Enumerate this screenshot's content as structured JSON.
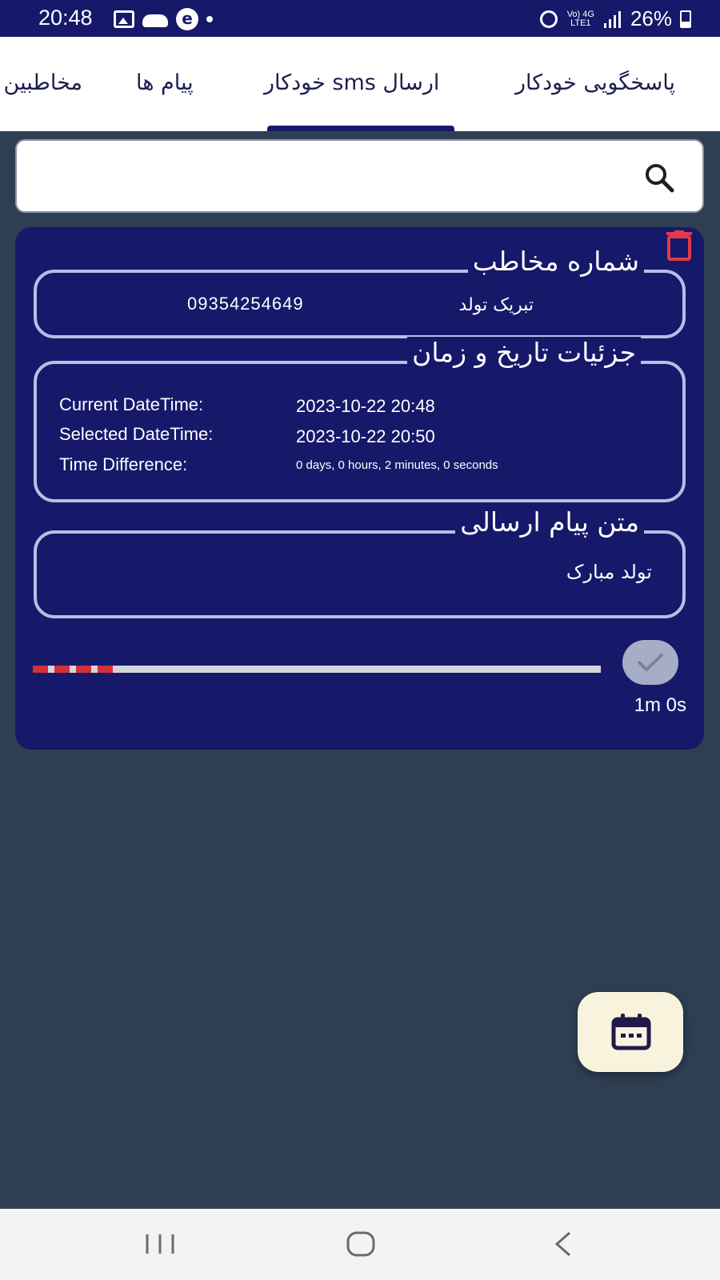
{
  "status_bar": {
    "time": "20:48",
    "network_top": "Vo) 4G",
    "network_bottom": "LTE1",
    "battery": "26%"
  },
  "tabs": [
    {
      "label": "پاسخگویی خودکار"
    },
    {
      "label": "ارسال sms خودکار",
      "active": true
    },
    {
      "label": "پیام ها"
    },
    {
      "label": "مخاطبین"
    }
  ],
  "search": {
    "placeholder": "",
    "value": ""
  },
  "card": {
    "contact_section": {
      "legend": "شماره مخاطب",
      "name": "تبریک تولد",
      "number": "09354254649"
    },
    "datetime_section": {
      "legend": "جزئیات تاریخ و زمان",
      "current_label": "Current DateTime:",
      "current_value": "2023-10-22 20:48",
      "selected_label": "Selected DateTime:",
      "selected_value": "2023-10-22 20:50",
      "difference_label": "Time Difference:",
      "difference_value": "0 days, 0 hours, 2 minutes, 0 seconds"
    },
    "message_section": {
      "legend": "متن پیام ارسالی",
      "text": "تولد مبارک"
    },
    "progress_fraction": 0.15,
    "countdown": "1m 0s"
  },
  "colors": {
    "primary": "#16196a",
    "background": "#2e3f53",
    "delete": "#e03b4b",
    "progress": "#d3303a",
    "fab": "#f7f3dc"
  },
  "icons": [
    "search-icon",
    "trash-icon",
    "check-icon",
    "calendar-icon",
    "recent-apps-icon",
    "home-icon",
    "back-icon"
  ]
}
